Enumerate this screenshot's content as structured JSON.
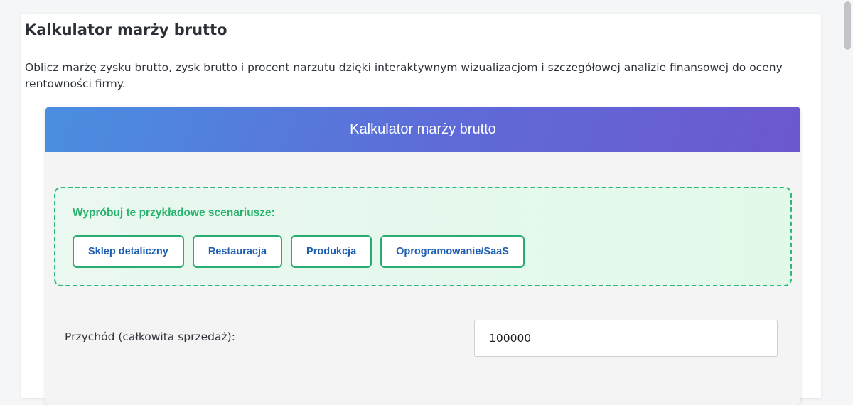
{
  "page": {
    "title": "Kalkulator marży brutto",
    "description": "Oblicz marżę zysku brutto, zysk brutto i procent narzutu dzięki interaktywnym wizualizacjom i szczegółowej analizie finansowej do oceny rentowności firmy."
  },
  "calculator": {
    "title": "Kalkulator marży brutto",
    "scenarios": {
      "heading": "Wypróbuj te przykładowe scenariusze:",
      "buttons": [
        "Sklep detaliczny",
        "Restauracja",
        "Produkcja",
        "Oprogramowanie/SaaS"
      ]
    },
    "revenue": {
      "label": "Przychód (całkowita sprzedaż):",
      "value": "100000"
    }
  },
  "colors": {
    "header_gradient_start": "#4a8fe0",
    "header_gradient_end": "#6c58cf",
    "scenario_accent": "#2db87a",
    "scenario_button_text": "#1f5fb1"
  }
}
